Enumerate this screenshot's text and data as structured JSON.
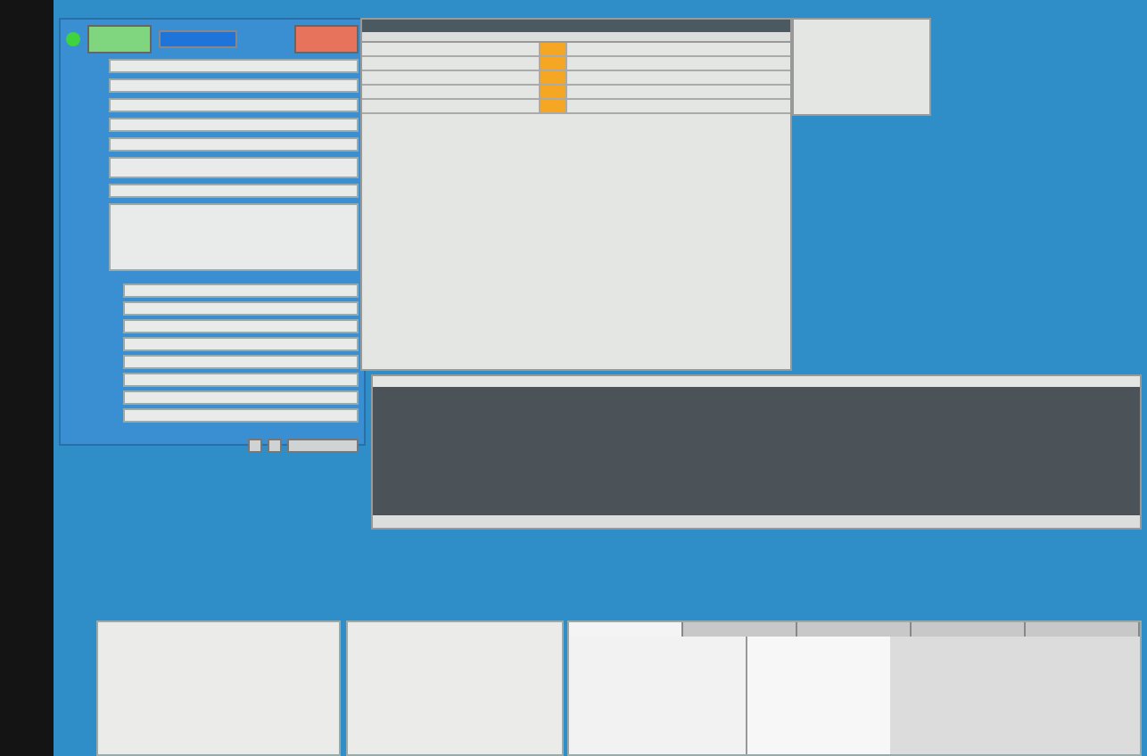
{
  "status_light": {
    "on": true
  },
  "top_buttons": [
    {
      "color": "#7fd67f"
    },
    {
      "color": "#e8735c"
    }
  ],
  "units_table": {
    "rows": [
      {
        "color": "#f5a623"
      },
      {
        "color": "#f5a623"
      },
      {
        "color": "#f5a623"
      },
      {
        "color": "#f5a623"
      },
      {
        "color": "#f5a623"
      }
    ]
  },
  "bottom_tabs": [
    {
      "selected": true
    },
    {
      "selected": false
    },
    {
      "selected": false
    },
    {
      "selected": false
    },
    {
      "selected": false
    }
  ]
}
